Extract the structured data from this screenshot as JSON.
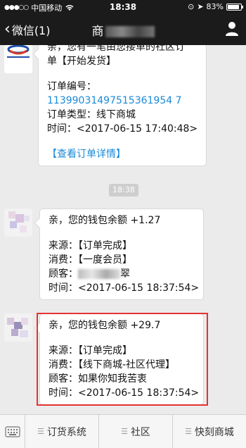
{
  "status_bar": {
    "carrier": "中国移动",
    "time": "18:38",
    "battery": "83%"
  },
  "nav": {
    "back_label": "微信(1)",
    "title": "商"
  },
  "messages": [
    {
      "intro_1": "亲，您有一笔由您接单的社区订",
      "intro_2": "单【开始发货】",
      "order_no_label": "订单编号：",
      "order_no": "11399031497515361954 7",
      "order_type": "订单类型：线下商城",
      "time": "时间：<2017-06-15 17:40:48>",
      "link": "【查看订单详情】"
    },
    {
      "headline": "亲，您的钱包余额 +1.27",
      "source": "来源：【订单完成】",
      "consume": "消费：【一度会员】",
      "customer_label": "顾客：",
      "customer_tail": "翠",
      "time": "时间：<2017-06-15 18:37:54>"
    },
    {
      "headline": "亲，您的钱包余额 +29.7",
      "source": "来源：【订单完成】",
      "consume": "消费：【线下商城-社区代理】",
      "customer": "顾客：如果你知我苦衷",
      "time": "时间：<2017-06-15 18:37:54>"
    }
  ],
  "time_divider": "18:38",
  "bottom_menu": [
    "订货系统",
    "社区",
    "快刻商城"
  ],
  "colors": {
    "link": "#1a8ad8",
    "highlight": "#e53232",
    "header_bg": "#1b1b1b"
  }
}
